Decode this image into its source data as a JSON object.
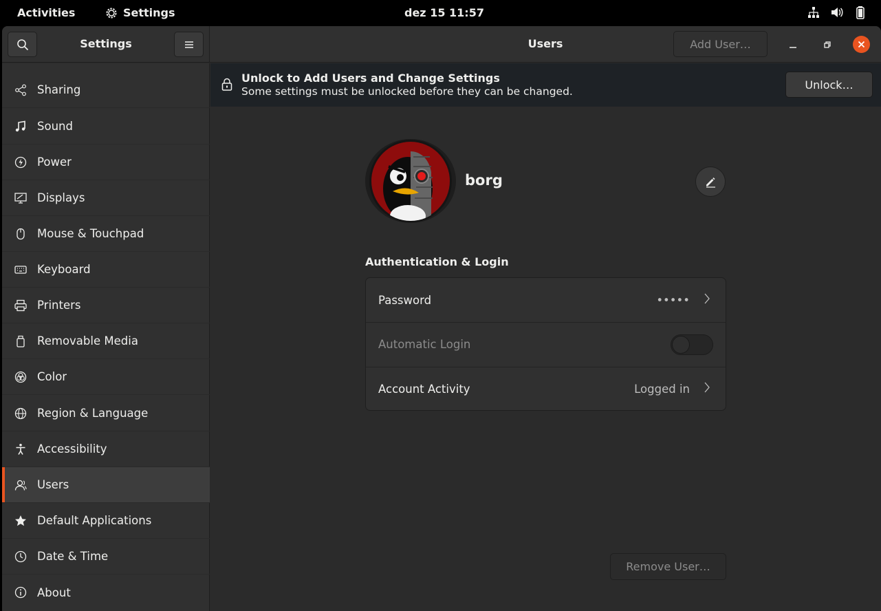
{
  "topbar": {
    "activities": "Activities",
    "app_name": "Settings",
    "clock": "dez 15  11:57",
    "icons": [
      "network-icon",
      "volume-icon",
      "battery-icon"
    ]
  },
  "header": {
    "sidebar_title": "Settings",
    "page_title": "Users",
    "add_user_label": "Add User…"
  },
  "sidebar": {
    "items": [
      {
        "label": "Sharing",
        "icon": "share-icon"
      },
      {
        "label": "Sound",
        "icon": "music-note-icon"
      },
      {
        "label": "Power",
        "icon": "power-icon"
      },
      {
        "label": "Displays",
        "icon": "display-icon"
      },
      {
        "label": "Mouse & Touchpad",
        "icon": "mouse-icon"
      },
      {
        "label": "Keyboard",
        "icon": "keyboard-icon"
      },
      {
        "label": "Printers",
        "icon": "printer-icon"
      },
      {
        "label": "Removable Media",
        "icon": "removable-media-icon"
      },
      {
        "label": "Color",
        "icon": "color-icon"
      },
      {
        "label": "Region & Language",
        "icon": "globe-icon"
      },
      {
        "label": "Accessibility",
        "icon": "accessibility-icon"
      },
      {
        "label": "Users",
        "icon": "users-icon",
        "active": true
      },
      {
        "label": "Default Applications",
        "icon": "star-icon"
      },
      {
        "label": "Date & Time",
        "icon": "clock-icon"
      },
      {
        "label": "About",
        "icon": "info-icon"
      }
    ]
  },
  "infobar": {
    "title": "Unlock to Add Users and Change Settings",
    "subtitle": "Some settings must be unlocked before they can be changed.",
    "unlock_label": "Unlock…"
  },
  "user": {
    "name": "borg"
  },
  "auth": {
    "section_title": "Authentication & Login",
    "password_label": "Password",
    "password_value": "•••••",
    "auto_login_label": "Automatic Login",
    "auto_login_enabled": false,
    "activity_label": "Account Activity",
    "activity_value": "Logged in"
  },
  "remove_user_label": "Remove User…",
  "colors": {
    "accent": "#e95420",
    "window_bg": "#2b2b2b",
    "sidebar_bg": "#303030",
    "infobar_bg": "#1e2226"
  }
}
